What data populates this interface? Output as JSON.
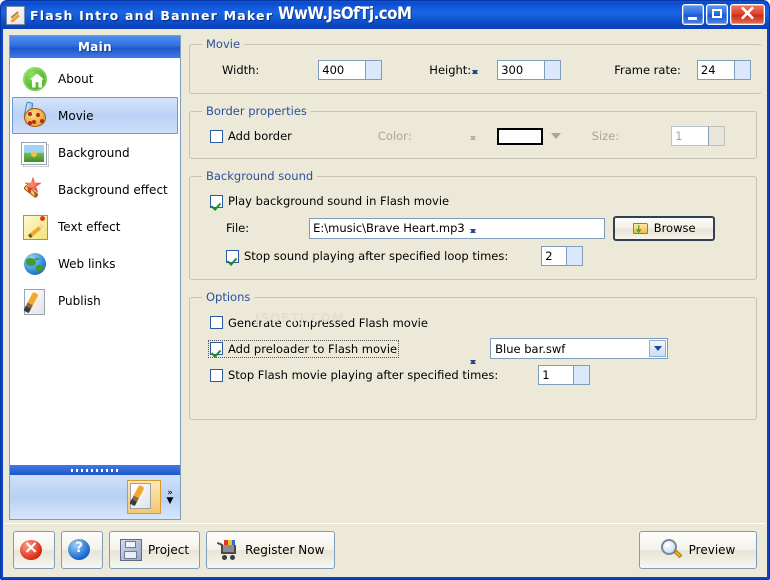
{
  "window": {
    "title": "Flash Intro and Banner Maker",
    "watermark_title": "WwW.JsOfTj.coM",
    "watermark_body": "JSOFTJ.COM",
    "icon": "app-pencil-icon",
    "buttons": {
      "minimize": "minimize-button",
      "maximize": "maximize-button",
      "close": "close-button"
    },
    "accent_color": "#0a42c8",
    "client_color": "#ece9d8"
  },
  "sidebar": {
    "header": "Main",
    "items": [
      {
        "label": "About",
        "icon": "home-icon",
        "selected": false
      },
      {
        "label": "Movie",
        "icon": "palette-icon",
        "selected": true
      },
      {
        "label": "Background",
        "icon": "photo-icon",
        "selected": false
      },
      {
        "label": "Background effect",
        "icon": "magic-wand-icon",
        "selected": false
      },
      {
        "label": "Text effect",
        "icon": "pencil-page-icon",
        "selected": false
      },
      {
        "label": "Web links",
        "icon": "globe-icon",
        "selected": false
      },
      {
        "label": "Publish",
        "icon": "publish-brush-icon",
        "selected": false
      }
    ],
    "footer": {
      "icon": "publish-brush-icon",
      "expand_label": "»",
      "more_label": "▼"
    }
  },
  "main": {
    "movie": {
      "legend": "Movie",
      "width_label": "Width:",
      "width_value": "400",
      "height_label": "Height:",
      "height_value": "300",
      "framerate_label": "Frame rate:",
      "framerate_value": "24"
    },
    "border": {
      "legend": "Border properties",
      "add_border_label": "Add border",
      "add_border_checked": false,
      "color_label": "Color:",
      "color_value": "#ffffff",
      "size_label": "Size:",
      "size_value": "1",
      "disabled": true
    },
    "sound": {
      "legend": "Background sound",
      "play_label": "Play background sound in Flash movie",
      "play_checked": true,
      "file_label": "File:",
      "file_value": "E:\\music\\Brave Heart.mp3",
      "browse_label": "Browse",
      "stop_label": "Stop sound playing after specified loop times:",
      "stop_checked": true,
      "loop_value": "2"
    },
    "options": {
      "legend": "Options",
      "compress_label": "Generate compressed Flash movie",
      "compress_checked": false,
      "preloader_label": "Add preloader to Flash movie",
      "preloader_checked": true,
      "preloader_focused": true,
      "preloader_value": "Blue bar.swf",
      "stop_times_label": "Stop Flash movie playing after specified times:",
      "stop_times_checked": false,
      "stop_times_value": "1"
    }
  },
  "bottombar": {
    "exit_label": "",
    "help_label": "",
    "project_label": "Project",
    "register_label": "Register Now",
    "preview_label": "Preview"
  }
}
